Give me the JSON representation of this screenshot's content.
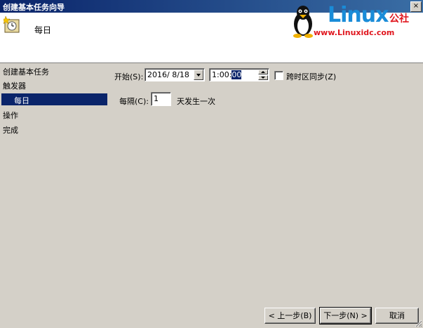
{
  "window": {
    "title": "创建基本任务向导",
    "close_label": "×"
  },
  "header": {
    "title": "每日"
  },
  "watermark": {
    "brand": "Linux",
    "brand_cn": "公社",
    "url": "www.Linuxidc.com"
  },
  "nav": {
    "items": [
      {
        "label": "创建基本任务"
      },
      {
        "label": "触发器"
      },
      {
        "label": "每日"
      },
      {
        "label": "操作"
      },
      {
        "label": "完成"
      }
    ]
  },
  "form": {
    "start_label": "开始(S):",
    "start_date": "2016/  8/18",
    "start_time_prefix": "1:00:",
    "start_time_selected": "00",
    "sync_tz_label": "跨时区同步(Z)",
    "sync_tz_checked": false,
    "recur_label": "每隔(C):",
    "recur_value": "1",
    "recur_unit": "天发生一次"
  },
  "buttons": {
    "back": "< 上一步(B)",
    "next": "下一步(N) >",
    "cancel": "取消"
  }
}
